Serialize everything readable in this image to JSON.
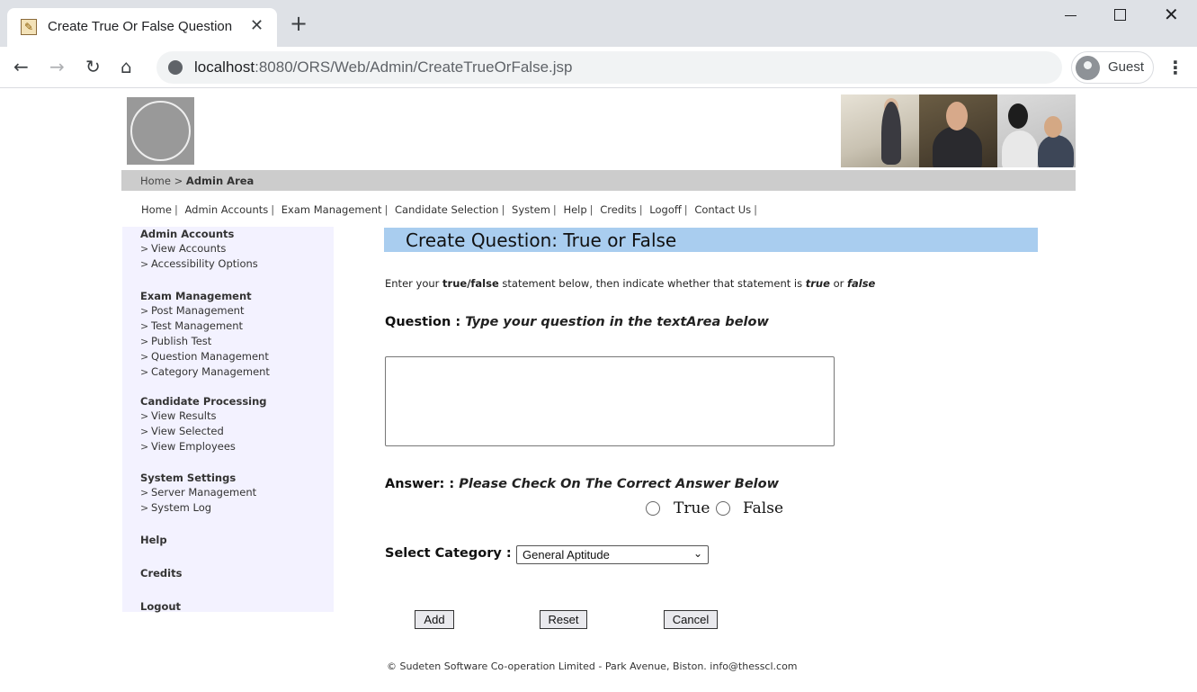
{
  "browser": {
    "tab_title": "Create True Or False Question",
    "tab_close": "✕",
    "new_tab": "+",
    "url_host": "localhost",
    "url_path": ":8080/ORS/Web/Admin/CreateTrueOrFalse.jsp",
    "profile_label": "Guest",
    "icons": {
      "back": "arrow-left-icon",
      "forward": "arrow-right-icon",
      "reload": "reload-icon",
      "home": "home-icon",
      "site_info": "site-info-icon",
      "menu": "kebab-menu-icon"
    }
  },
  "breadcrumb": {
    "home": "Home",
    "sep": ">",
    "current": "Admin Area"
  },
  "topnav": [
    "Home",
    "Admin Accounts",
    "Exam Management",
    "Candidate Selection",
    "System",
    "Help",
    "Credits",
    "Logoff",
    "Contact Us"
  ],
  "topnav_sep": "|",
  "sidebar": {
    "groups": [
      {
        "heading": "Admin Accounts",
        "items": [
          "View Accounts",
          "Accessibility Options"
        ]
      },
      {
        "heading": "Exam Management",
        "items": [
          "Post Management",
          "Test Management",
          "Publish Test",
          "Question Management",
          "Category Management"
        ]
      },
      {
        "heading": "Candidate Processing",
        "items": [
          "View Results",
          "View Selected",
          "View Employees"
        ]
      },
      {
        "heading": "System Settings",
        "items": [
          "Server Management",
          "System Log"
        ]
      },
      {
        "heading": "Help",
        "items": []
      },
      {
        "heading": "Credits",
        "items": []
      },
      {
        "heading": "Logout",
        "items": []
      }
    ],
    "chevron": ">"
  },
  "content": {
    "title": "Create Question: True or False",
    "instructions": {
      "p1": "Enter your ",
      "b1": "true/false",
      "p2": " statement below, then indicate whether that statement is ",
      "b2": "true",
      "p3": " or ",
      "b3": "false"
    },
    "question_label": "Question : ",
    "question_hint": "Type your question in the textArea below",
    "question_value": "",
    "answer_label": "Answer: : ",
    "answer_hint": "Please Check On The Correct Answer Below",
    "answer_options": [
      "True",
      "False"
    ],
    "category_label": "Select Category :",
    "category_selected": "General Aptitude",
    "buttons": {
      "add": "Add",
      "reset": "Reset",
      "cancel": "Cancel"
    }
  },
  "footer": "© Sudeten Software Co-operation Limited - Park Avenue, Biston. info@thesscl.com"
}
